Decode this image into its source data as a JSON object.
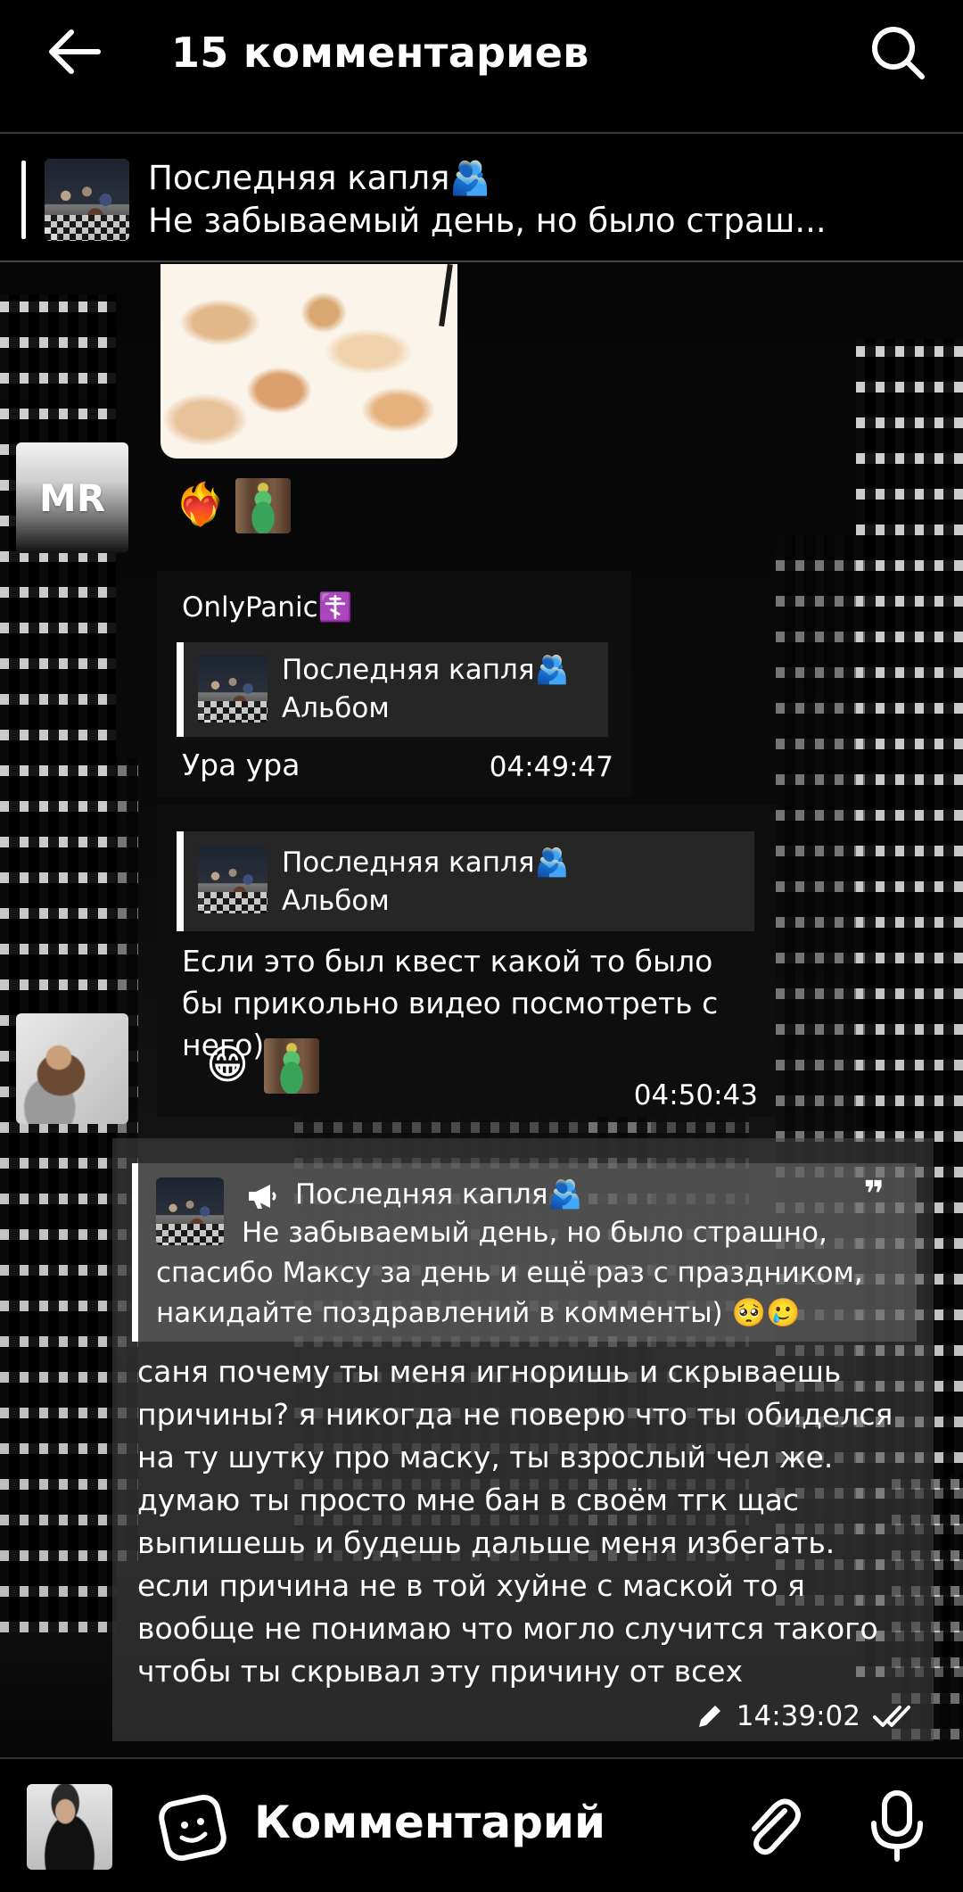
{
  "header": {
    "title": "15 комментариев"
  },
  "pinned": {
    "title": "Последняя капля🫂",
    "text": "Не забываемый день, но было страш..."
  },
  "messages": [
    {
      "reactions": [
        "❤️‍🔥"
      ]
    },
    {
      "author": "OnlyPanic☦️",
      "reply_title": "Последняя капля🫂",
      "reply_subtitle": "Альбом",
      "text": "Ура ура",
      "time": "04:49:47"
    },
    {
      "reply_title": "Последняя капля🫂",
      "reply_subtitle": "Альбом",
      "text": "Если это был квест какой то было бы прикольно видео посмотреть с него)",
      "reaction": "😁",
      "time": "04:50:43"
    }
  ],
  "mine": {
    "quote_title": "Последняя капля🫂",
    "quote_text": "Не забываемый день, но было страшно, спасибо Максу за день и ещё раз с праздником, накидайте поздравлений в комменты) 🥺🥲",
    "quote_mark": "❞",
    "text_lines": [
      "саня почему ты меня игноришь и скрываешь",
      "причины? я никогда не поверю что ты обиделся",
      "на ту шутку про маску, ты взрослый чел же.",
      "думаю ты просто мне бан в своём тгк щас",
      "выпишешь и будешь дальше меня избегать.",
      "если причина не в той хуйне с маской то я",
      "вообще не понимаю что могло случится такого",
      "чтобы ты скрывал эту причину от всех"
    ],
    "time": "14:39:02",
    "edited_icon": "pencil-icon",
    "status_icon": "double-check-icon"
  },
  "avatars": {
    "mr_initials": "MR"
  },
  "composer": {
    "placeholder": "Комментарий"
  }
}
